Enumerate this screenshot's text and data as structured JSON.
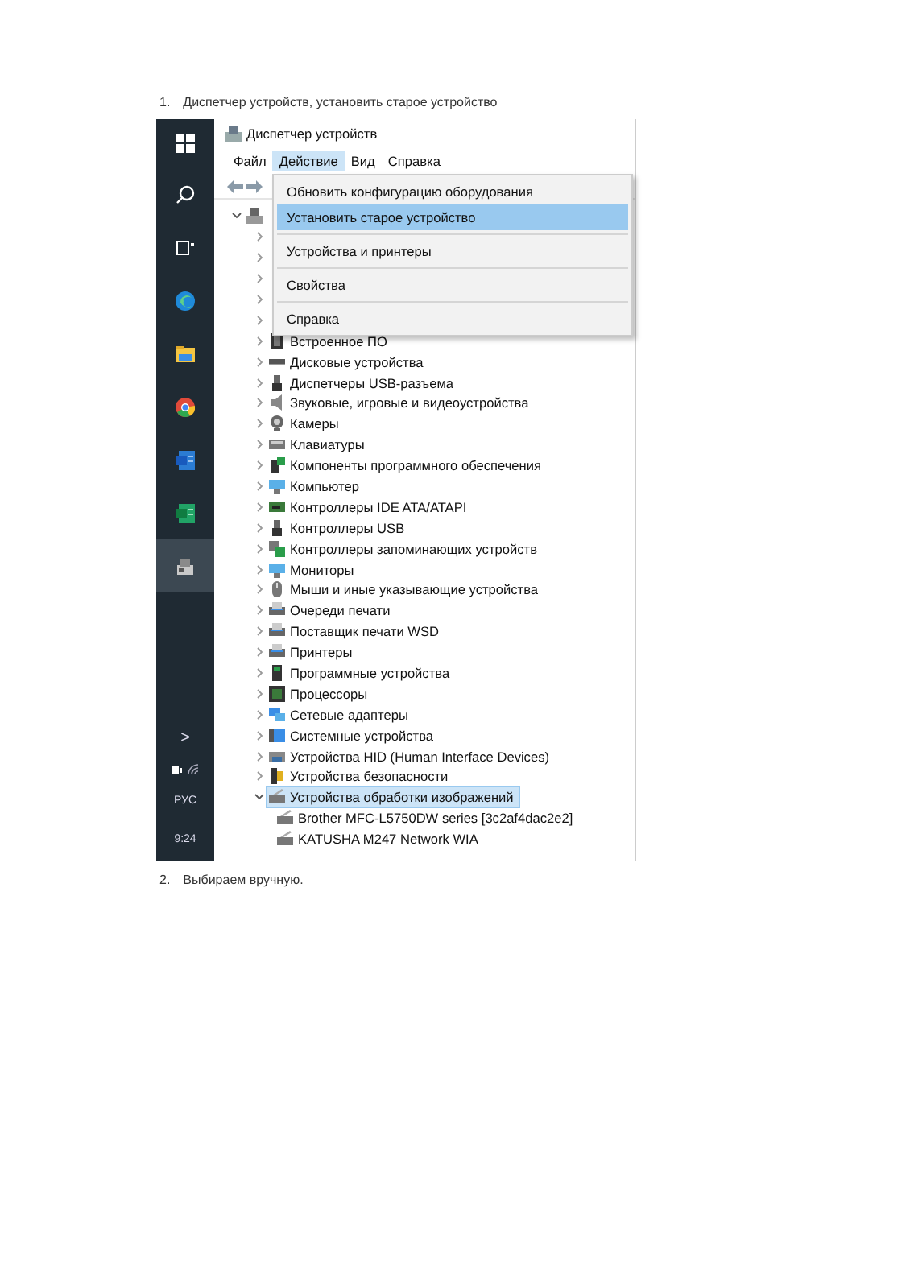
{
  "steps": [
    {
      "number": "1.",
      "text": "Диспетчер устройств, установить старое устройство"
    },
    {
      "number": "2.",
      "text": "Выбираем вручную."
    }
  ],
  "taskbar": {
    "apps": [
      {
        "selected": false
      },
      {
        "selected": false
      },
      {
        "selected": false
      },
      {
        "selected": false
      },
      {
        "selected": false
      },
      {
        "selected": true
      }
    ],
    "language": "РУС",
    "time": "9:24",
    "tray_chevron": ">"
  },
  "window": {
    "title": "Диспетчер устройств"
  },
  "menu_bar": [
    {
      "label": "Файл",
      "selected": false
    },
    {
      "label": "Действие",
      "selected": true
    },
    {
      "label": "Вид",
      "selected": false
    },
    {
      "label": "Справка",
      "selected": false
    }
  ],
  "dropdown": [
    {
      "kind": "item",
      "label": "Обновить конфигурацию оборудования",
      "selected": false
    },
    {
      "kind": "item",
      "label": "Установить старое устройство",
      "selected": true
    },
    {
      "kind": "separator"
    },
    {
      "kind": "item",
      "label": "Устройства и принтеры",
      "selected": false
    },
    {
      "kind": "separator"
    },
    {
      "kind": "item",
      "label": "Свойства",
      "selected": false
    },
    {
      "kind": "separator"
    },
    {
      "kind": "item",
      "label": "Справка",
      "selected": false
    }
  ],
  "tree": [
    {
      "expanded": true,
      "children": [
        {
          "expanded": false
        },
        {
          "expanded": false
        },
        {
          "expanded": false
        },
        {
          "expanded": false
        },
        {
          "expanded": false
        },
        {
          "label": "Встроенное ПО",
          "expanded": false,
          "selected": false
        },
        {
          "label": "Дисковые устройства",
          "expanded": false,
          "selected": false
        },
        {
          "label": "Диспетчеры USB-разъема",
          "expanded": false,
          "selected": false
        },
        {
          "label": "Звуковые, игровые и видеоустройства",
          "expanded": false,
          "selected": false
        },
        {
          "label": "Камеры",
          "expanded": false,
          "selected": false
        },
        {
          "label": "Клавиатуры",
          "expanded": false,
          "selected": false
        },
        {
          "label": "Компоненты программного обеспечения",
          "expanded": false,
          "selected": false
        },
        {
          "label": "Компьютер",
          "expanded": false,
          "selected": false
        },
        {
          "label": "Контроллеры IDE ATA/ATAPI",
          "expanded": false,
          "selected": false
        },
        {
          "label": "Контроллеры USB",
          "expanded": false,
          "selected": false
        },
        {
          "label": "Контроллеры запоминающих устройств",
          "expanded": false,
          "selected": false
        },
        {
          "label": "Мониторы",
          "expanded": false,
          "selected": false
        },
        {
          "label": "Мыши и иные указывающие устройства",
          "expanded": false,
          "selected": false
        },
        {
          "label": "Очереди печати",
          "expanded": false,
          "selected": false
        },
        {
          "label": "Поставщик печати WSD",
          "expanded": false,
          "selected": false
        },
        {
          "label": "Принтеры",
          "expanded": false,
          "selected": false
        },
        {
          "label": "Программные устройства",
          "expanded": false,
          "selected": false
        },
        {
          "label": "Процессоры",
          "expanded": false,
          "selected": false
        },
        {
          "label": "Сетевые адаптеры",
          "expanded": false,
          "selected": false
        },
        {
          "label": "Системные устройства",
          "expanded": false,
          "selected": false
        },
        {
          "label": "Устройства HID (Human Interface Devices)",
          "expanded": false,
          "selected": false
        },
        {
          "label": "Устройства безопасности",
          "expanded": false,
          "selected": false
        },
        {
          "label": "Устройства обработки изображений",
          "expanded": true,
          "selected": true,
          "children": [
            {
              "label": "Brother MFC-L5750DW series [3c2af4dac2e2]",
              "selected": false
            },
            {
              "label": "KATUSHA M247 Network WIA",
              "selected": false
            }
          ]
        }
      ]
    }
  ]
}
